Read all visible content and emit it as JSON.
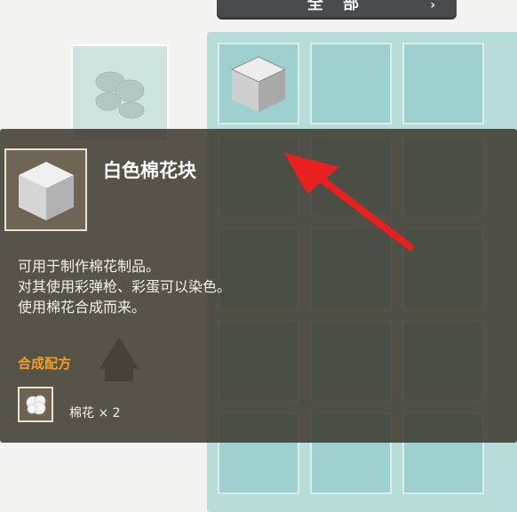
{
  "top_button": {
    "label": "全 部",
    "chevron": "›"
  },
  "tooltip": {
    "title": "白色棉花块",
    "description": [
      "可用于制作棉花制品。",
      "对其使用彩弹枪、彩蛋可以染色。",
      "使用棉花合成而来。"
    ],
    "recipe_header": "合成配方",
    "recipe_ingredient": "棉花 × 2",
    "icon": "white-cotton-block-icon",
    "ingredient_icon": "cotton-icon"
  },
  "inventory": {
    "first_slot_item": "white-cotton-block-icon"
  },
  "colors": {
    "slot_teal": "#9fd0d0",
    "panel_teal": "#b8dcd7",
    "tooltip_bg": "#3e382c",
    "recipe_header": "#f0a020",
    "arrow": "#e82020"
  }
}
